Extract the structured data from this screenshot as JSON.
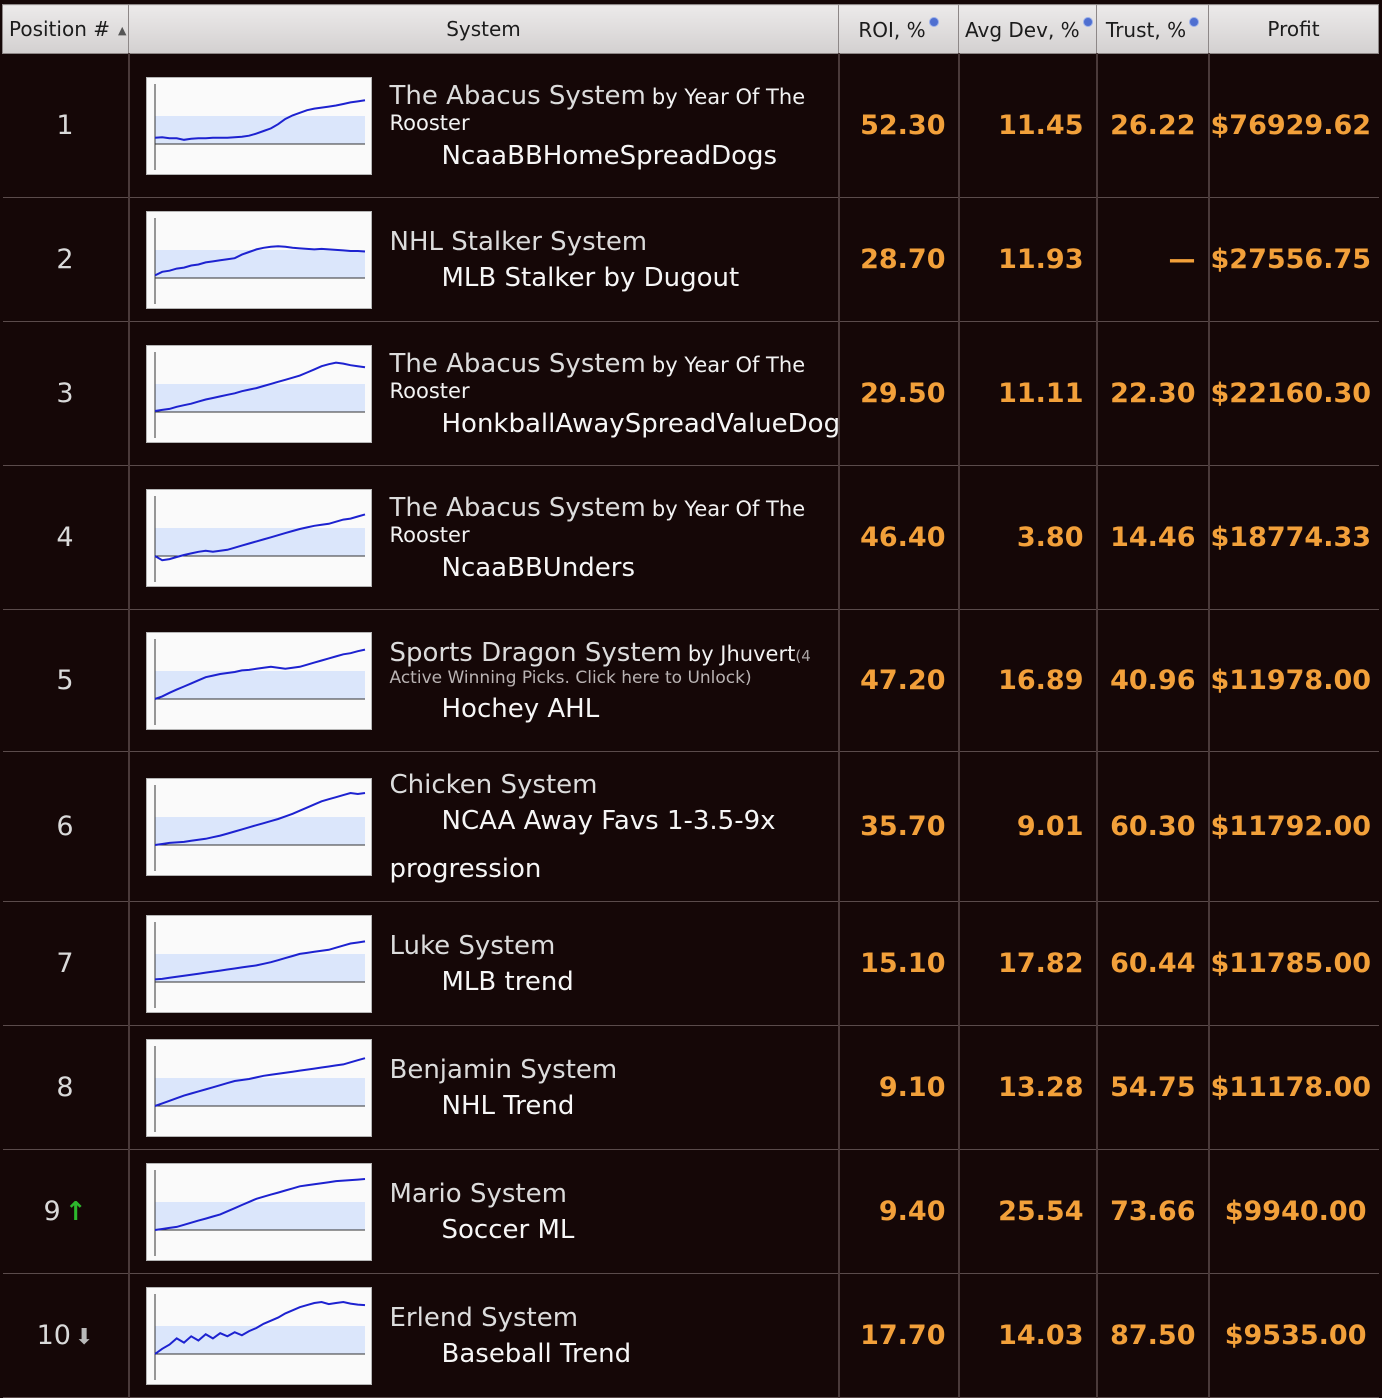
{
  "header": {
    "position": "Position #",
    "system": "System",
    "roi": "ROI, %",
    "avg_dev": "Avg Dev, %",
    "trust": "Trust, %",
    "profit": "Profit"
  },
  "rows": [
    {
      "position": "1",
      "movement": "",
      "system_name": "The Abacus System",
      "by": "by Year Of The",
      "by_cont": "Rooster",
      "unlock_prefix": "",
      "unlock_text": "",
      "strategy": "NcaaBBHomeSpreadDogs",
      "strategy_cont": "",
      "roi": "52.30",
      "avg_dev": "11.45",
      "trust": "26.22",
      "profit": "$76929.62",
      "spark": [
        0.12,
        0.13,
        0.11,
        0.11,
        0.08,
        0.1,
        0.11,
        0.11,
        0.12,
        0.12,
        0.12,
        0.13,
        0.14,
        0.16,
        0.2,
        0.25,
        0.3,
        0.38,
        0.48,
        0.55,
        0.6,
        0.65,
        0.68,
        0.7,
        0.72,
        0.74,
        0.77,
        0.8,
        0.82,
        0.84
      ]
    },
    {
      "position": "2",
      "movement": "",
      "system_name": "NHL Stalker System",
      "by": "",
      "by_cont": "",
      "unlock_prefix": "",
      "unlock_text": "",
      "strategy": "MLB Stalker by Dugout",
      "strategy_cont": "",
      "roi": "28.70",
      "avg_dev": "11.93",
      "trust": "—",
      "profit": "$27556.75",
      "spark": [
        0.05,
        0.12,
        0.14,
        0.18,
        0.2,
        0.24,
        0.26,
        0.3,
        0.32,
        0.34,
        0.36,
        0.38,
        0.45,
        0.5,
        0.55,
        0.58,
        0.6,
        0.61,
        0.6,
        0.58,
        0.57,
        0.56,
        0.55,
        0.56,
        0.55,
        0.54,
        0.53,
        0.52,
        0.52,
        0.51
      ]
    },
    {
      "position": "3",
      "movement": "",
      "system_name": "The Abacus System",
      "by": "by Year Of The",
      "by_cont": "Rooster",
      "unlock_prefix": "",
      "unlock_text": "",
      "strategy": "HonkballAwaySpreadValueDog",
      "strategy_cont": "",
      "roi": "29.50",
      "avg_dev": "11.11",
      "trust": "22.30",
      "profit": "$22160.30",
      "spark": [
        0.02,
        0.04,
        0.06,
        0.1,
        0.13,
        0.16,
        0.2,
        0.24,
        0.27,
        0.3,
        0.33,
        0.36,
        0.4,
        0.43,
        0.46,
        0.5,
        0.54,
        0.58,
        0.62,
        0.66,
        0.7,
        0.76,
        0.82,
        0.88,
        0.92,
        0.95,
        0.93,
        0.9,
        0.88,
        0.86
      ]
    },
    {
      "position": "4",
      "movement": "",
      "system_name": "The Abacus System",
      "by": "by Year Of The",
      "by_cont": "Rooster",
      "unlock_prefix": "",
      "unlock_text": "",
      "strategy": "NcaaBBUnders",
      "strategy_cont": "",
      "roi": "46.40",
      "avg_dev": "3.80",
      "trust": "14.46",
      "profit": "$18774.33",
      "spark": [
        0.0,
        -0.08,
        -0.06,
        -0.02,
        0.02,
        0.05,
        0.08,
        0.1,
        0.08,
        0.1,
        0.12,
        0.16,
        0.2,
        0.24,
        0.28,
        0.32,
        0.36,
        0.4,
        0.44,
        0.48,
        0.52,
        0.55,
        0.58,
        0.6,
        0.62,
        0.66,
        0.7,
        0.72,
        0.76,
        0.8
      ]
    },
    {
      "position": "5",
      "movement": "",
      "system_name": "Sports Dragon System",
      "by": "by Jhuvert",
      "by_cont": "",
      "unlock_prefix": "(4",
      "unlock_text": "Active Winning Picks. Click here to Unlock)",
      "strategy": "Hochey AHL",
      "strategy_cont": "",
      "roi": "47.20",
      "avg_dev": "16.89",
      "trust": "40.96",
      "profit": "$11978.00",
      "spark": [
        0.0,
        0.05,
        0.12,
        0.18,
        0.24,
        0.3,
        0.36,
        0.42,
        0.45,
        0.48,
        0.5,
        0.52,
        0.55,
        0.56,
        0.58,
        0.6,
        0.62,
        0.6,
        0.58,
        0.6,
        0.62,
        0.66,
        0.7,
        0.74,
        0.78,
        0.82,
        0.86,
        0.88,
        0.92,
        0.95
      ]
    },
    {
      "position": "6",
      "movement": "",
      "system_name": "Chicken System",
      "by": "",
      "by_cont": "",
      "unlock_prefix": "",
      "unlock_text": "",
      "strategy": "NCAA Away Favs 1-3.5-9x",
      "strategy_cont": "progression",
      "roi": "35.70",
      "avg_dev": "9.01",
      "trust": "60.30",
      "profit": "$11792.00",
      "spark": [
        0.0,
        0.02,
        0.04,
        0.05,
        0.06,
        0.08,
        0.1,
        0.12,
        0.15,
        0.18,
        0.22,
        0.26,
        0.3,
        0.34,
        0.38,
        0.42,
        0.46,
        0.5,
        0.55,
        0.6,
        0.66,
        0.72,
        0.78,
        0.84,
        0.88,
        0.92,
        0.96,
        1.0,
        0.98,
        1.0
      ]
    },
    {
      "position": "7",
      "movement": "",
      "system_name": "Luke System",
      "by": "",
      "by_cont": "",
      "unlock_prefix": "",
      "unlock_text": "",
      "strategy": "MLB trend",
      "strategy_cont": "",
      "roi": "15.10",
      "avg_dev": "17.82",
      "trust": "60.44",
      "profit": "$11785.00",
      "spark": [
        0.05,
        0.06,
        0.08,
        0.1,
        0.12,
        0.14,
        0.16,
        0.18,
        0.2,
        0.22,
        0.24,
        0.26,
        0.28,
        0.3,
        0.32,
        0.35,
        0.38,
        0.42,
        0.46,
        0.5,
        0.54,
        0.56,
        0.58,
        0.6,
        0.62,
        0.66,
        0.7,
        0.74,
        0.76,
        0.78
      ]
    },
    {
      "position": "8",
      "movement": "",
      "system_name": "Benjamin System",
      "by": "",
      "by_cont": "",
      "unlock_prefix": "",
      "unlock_text": "",
      "strategy": "NHL Trend",
      "strategy_cont": "",
      "roi": "9.10",
      "avg_dev": "13.28",
      "trust": "54.75",
      "profit": "$11178.00",
      "spark": [
        0.0,
        0.05,
        0.1,
        0.15,
        0.2,
        0.24,
        0.28,
        0.32,
        0.36,
        0.4,
        0.44,
        0.48,
        0.5,
        0.52,
        0.55,
        0.58,
        0.6,
        0.62,
        0.64,
        0.66,
        0.68,
        0.7,
        0.72,
        0.74,
        0.76,
        0.78,
        0.8,
        0.84,
        0.88,
        0.92
      ]
    },
    {
      "position": "9",
      "movement": "up",
      "system_name": "Mario System",
      "by": "",
      "by_cont": "",
      "unlock_prefix": "",
      "unlock_text": "",
      "strategy": "Soccer ML",
      "strategy_cont": "",
      "roi": "9.40",
      "avg_dev": "25.54",
      "trust": "73.66",
      "profit": "$9940.00",
      "spark": [
        0.0,
        0.02,
        0.04,
        0.06,
        0.1,
        0.14,
        0.18,
        0.22,
        0.26,
        0.3,
        0.36,
        0.42,
        0.48,
        0.54,
        0.6,
        0.64,
        0.68,
        0.72,
        0.76,
        0.8,
        0.84,
        0.86,
        0.88,
        0.9,
        0.92,
        0.94,
        0.95,
        0.96,
        0.97,
        0.98
      ]
    },
    {
      "position": "10",
      "movement": "down",
      "system_name": "Erlend System",
      "by": "",
      "by_cont": "",
      "unlock_prefix": "",
      "unlock_text": "",
      "strategy": "Baseball Trend",
      "strategy_cont": "",
      "roi": "17.70",
      "avg_dev": "14.03",
      "trust": "87.50",
      "profit": "$9535.00",
      "spark": [
        0.0,
        0.1,
        0.18,
        0.3,
        0.22,
        0.34,
        0.26,
        0.38,
        0.3,
        0.4,
        0.34,
        0.42,
        0.36,
        0.44,
        0.5,
        0.58,
        0.64,
        0.7,
        0.78,
        0.84,
        0.9,
        0.94,
        0.98,
        1.0,
        0.96,
        0.98,
        1.0,
        0.97,
        0.95,
        0.94
      ]
    }
  ],
  "colors": {
    "accent": "#f2a03a",
    "background": "#150707",
    "spark_line": "#1d22d0",
    "spark_band": "#dbe6fb",
    "arrow_up": "#2db82d"
  }
}
